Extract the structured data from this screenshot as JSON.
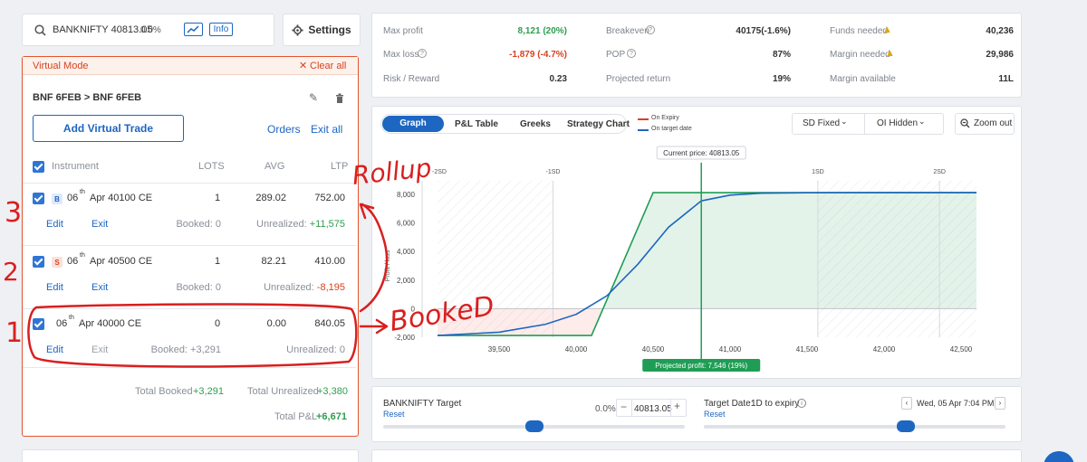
{
  "search": {
    "symbol": "BANKNIFTY 40813.05",
    "change": "0.0%",
    "info_label": "Info"
  },
  "settings_label": "Settings",
  "virtual": {
    "mode_label": "Virtual Mode",
    "clear_label": "Clear all",
    "strategy_title": "BNF 6FEB > BNF 6FEB",
    "add_label": "Add Virtual Trade",
    "orders_label": "Orders",
    "exit_all_label": "Exit all",
    "headers": {
      "instrument": "Instrument",
      "lots": "LOTS",
      "avg": "AVG",
      "ltp": "LTP"
    },
    "positions": [
      {
        "side": "B",
        "day": "06",
        "sup": "th",
        "name": "Apr 40100 CE",
        "lots": "1",
        "avg": "289.02",
        "ltp": "752.00",
        "edit": "Edit",
        "exit": "Exit",
        "booked": "Booked: 0",
        "unreal_label": "Unrealized: ",
        "unreal_val": "+11,575"
      },
      {
        "side": "S",
        "day": "06",
        "sup": "th",
        "name": "Apr 40500 CE",
        "lots": "1",
        "avg": "82.21",
        "ltp": "410.00",
        "edit": "Edit",
        "exit": "Exit",
        "booked": "Booked: 0",
        "unreal_label": "Unrealized: ",
        "unreal_val": "-8,195"
      },
      {
        "side": "",
        "day": "06",
        "sup": "th",
        "name": "Apr 40000 CE",
        "lots": "0",
        "avg": "0.00",
        "ltp": "840.05",
        "edit": "Edit",
        "exit": "Exit",
        "booked": "Booked: +3,291",
        "unreal_label": "Unrealized: ",
        "unreal_val": "0"
      }
    ],
    "total_booked_label": "Total Booked ",
    "total_booked_val": "+3,291",
    "total_unreal_label": "Total Unrealized ",
    "total_unreal_val": "+3,380",
    "total_pnl_label": "Total P&L ",
    "total_pnl_val": "+6,671"
  },
  "metrics": {
    "max_profit_label": "Max profit",
    "max_profit_val": "8,121 (20%)",
    "max_loss_label": "Max loss",
    "max_loss_val": "-1,879 (-4.7%)",
    "rr_label": "Risk / Reward",
    "rr_val": "0.23",
    "breakeven_label": "Breakeven",
    "breakeven_val": "40175(-1.6%)",
    "pop_label": "POP",
    "pop_val": "87%",
    "proj_return_label": "Projected return",
    "proj_return_val": "19%",
    "funds_label": "Funds needed",
    "funds_val": "40,236",
    "margin_label": "Margin needed",
    "margin_val": "29,986",
    "margin_avail_label": "Margin available",
    "margin_avail_val": "11L"
  },
  "tabs": {
    "graph": "Graph",
    "pnl_table": "P&L Table",
    "greeks": "Greeks",
    "strategy_chart": "Strategy Chart"
  },
  "legend": {
    "expiry": "On Expiry",
    "target": "On target date"
  },
  "sd_select": "SD Fixed",
  "oi_select": "OI Hidden",
  "zoom_label": "Zoom out",
  "current_price_label": "Current price: 40813.05",
  "projected_profit_label": "Projected profit: 7,546 (19%)",
  "target": {
    "label": "BANKNIFTY Target",
    "reset": "Reset",
    "pct": "0.0%",
    "value": "40813.05",
    "date_label": "Target Date:",
    "date_days": "1D to expiry",
    "date_reset": "Reset",
    "date_value": "Wed, 05 Apr 7:04 PM"
  },
  "annotations": {
    "rollup": "Rollup",
    "booked": "BookeD",
    "n3": "3",
    "n2": "2",
    "n1": "1"
  },
  "colors": {
    "accent": "#1d66c2",
    "expiry_line": "#1f9d55",
    "target_line": "#1d66c2",
    "annotation": "#d91f1f"
  },
  "chart_data": {
    "type": "line",
    "x_tick_labels": [
      "39,500",
      "40,000",
      "40,500",
      "41,000",
      "41,500",
      "42,000",
      "42,500"
    ],
    "x_ticks": [
      39500,
      40000,
      40500,
      41000,
      41500,
      42000,
      42500
    ],
    "y_tick_labels": [
      "8,000",
      "6,000",
      "4,000",
      "2,000",
      "0",
      "-2,000"
    ],
    "y_ticks": [
      8000,
      6000,
      4000,
      2000,
      0,
      -2000
    ],
    "xlim": [
      39100,
      42600
    ],
    "ylim": [
      -2000,
      8000
    ],
    "ylabel": "Profit / loss",
    "sd_labels": [
      "-2SD",
      "-1SD",
      "1SD",
      "2SD"
    ],
    "sd_positions": [
      39000,
      39850,
      41570,
      42360
    ],
    "current_price": 40813.05,
    "series": [
      {
        "name": "On Expiry",
        "color": "#1f9d55",
        "x": [
          39100,
          40100,
          40500,
          42600
        ],
        "y": [
          -1879,
          -1879,
          8121,
          8121
        ]
      },
      {
        "name": "On target date",
        "color": "#1d66c2",
        "x": [
          39100,
          39500,
          39800,
          40000,
          40200,
          40400,
          40600,
          40813,
          41000,
          41200,
          41500,
          42000,
          42600
        ],
        "y": [
          -1879,
          -1650,
          -1100,
          -400,
          900,
          3100,
          5700,
          7546,
          7950,
          8080,
          8115,
          8121,
          8121
        ]
      }
    ]
  }
}
